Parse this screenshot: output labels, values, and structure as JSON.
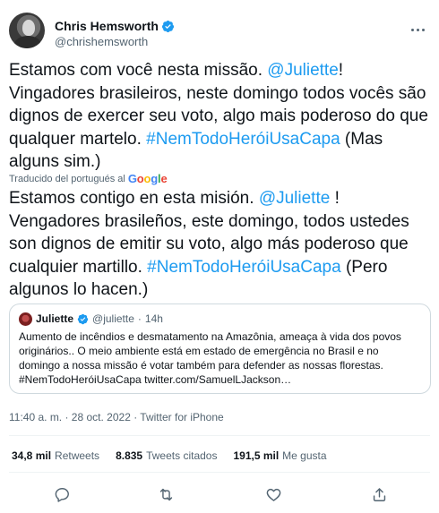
{
  "author": {
    "name": "Chris Hemsworth",
    "handle": "@chrishemsworth"
  },
  "tweet": {
    "original": {
      "part1": "Estamos com você nesta missão. ",
      "mention": "@Juliette",
      "part2": "! Vingadores brasileiros, neste domingo todos vocês são dignos de exercer seu voto, algo mais poderoso do que qualquer martelo. ",
      "hashtag": "#NemTodoHeróiUsaCapa",
      "part3": " (Mas alguns sim.)"
    },
    "translation_notice": "Traducido del portugués al",
    "translation_provider": "Google",
    "translated": {
      "part1": "Estamos contigo en esta misión. ",
      "mention": "@Juliette",
      "part2": " ! Vengadores brasileños, este domingo, todos ustedes son dignos de emitir su voto, algo más poderoso que cualquier martillo. ",
      "hashtag": "#NemTodoHeróiUsaCapa",
      "part3": " (Pero algunos lo hacen.)"
    }
  },
  "quote": {
    "name": "Juliette",
    "handle": "@juliette",
    "separator": "·",
    "time": "14h",
    "text": "Aumento de incêndios e desmatamento na Amazônia, ameaça à vida dos povos originários.. O meio ambiente está em estado de emergência no Brasil e no domingo a nossa missão é votar também para defender as nossas florestas. #NemTodoHeróiUsaCapa twitter.com/SamuelLJackson…"
  },
  "timestamp": "11:40 a. m. · 28 oct. 2022 · Twitter for iPhone",
  "stats": [
    {
      "count": "34,8 mil",
      "label": "Retweets"
    },
    {
      "count": "8.835",
      "label": "Tweets citados"
    },
    {
      "count": "191,5 mil",
      "label": "Me gusta"
    }
  ],
  "icons": {
    "verified": "verified-badge-icon",
    "more": "more-options-icon",
    "reply": "reply-icon",
    "retweet": "retweet-icon",
    "like": "like-icon",
    "share": "share-icon"
  },
  "colors": {
    "link": "#1d9bf0",
    "secondary_text": "#536471",
    "primary_text": "#0f1419",
    "border": "#cfd9de"
  }
}
